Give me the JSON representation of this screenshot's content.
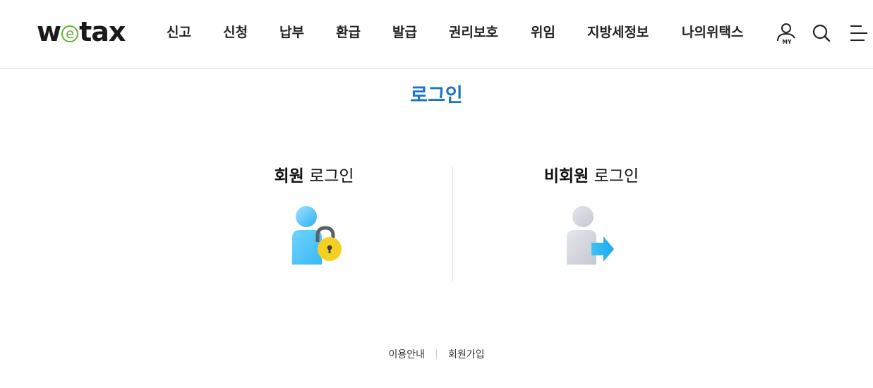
{
  "header": {
    "logo": {
      "prefix": "w",
      "e": "e",
      "suffix": "tax",
      "accent": "#5fb233"
    },
    "nav": [
      {
        "label": "신고"
      },
      {
        "label": "신청"
      },
      {
        "label": "납부"
      },
      {
        "label": "환급"
      },
      {
        "label": "발급"
      },
      {
        "label": "권리보호"
      },
      {
        "label": "위임"
      },
      {
        "label": "지방세정보"
      },
      {
        "label": "나의위택스"
      }
    ],
    "utility": {
      "my_label": "MY",
      "my_icon": "user-my-icon",
      "search_icon": "search-icon",
      "menu_icon": "hamburger-menu-icon"
    }
  },
  "main": {
    "title": "로그인",
    "title_color": "#1a73c9",
    "member": {
      "bold": "회원",
      "rest": " 로그인",
      "icon": "member-lock-icon"
    },
    "guest": {
      "bold": "비회원",
      "rest": " 로그인",
      "icon": "guest-arrow-icon"
    }
  },
  "footer": {
    "links": [
      {
        "label": "이용안내"
      },
      {
        "label": "회원가입"
      }
    ]
  }
}
